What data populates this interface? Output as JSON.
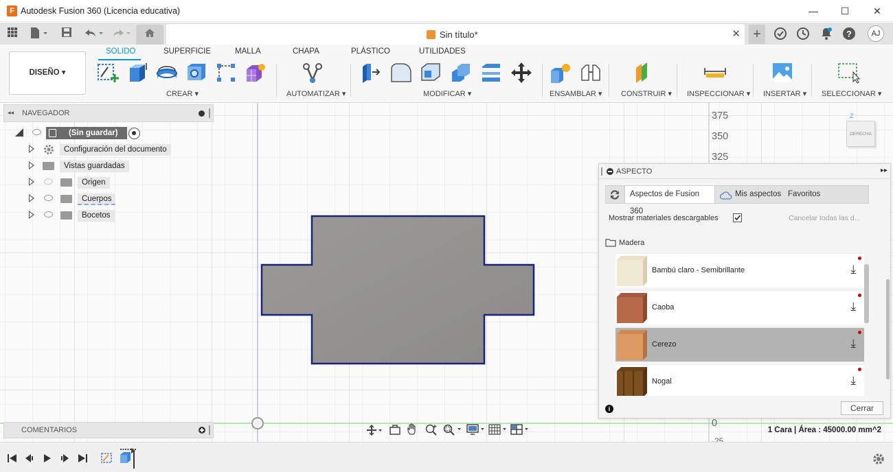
{
  "window": {
    "title": "Autodesk Fusion 360 (Licencia educativa)",
    "app_icon": "F",
    "minimize": "—",
    "maximize": "☐",
    "close": "✕"
  },
  "tabs": {
    "document_name": "Sin título*",
    "close_glyph": "✕",
    "add_glyph": "+",
    "user_initials": "AJ"
  },
  "ribbon": {
    "workspace_button": "DISEÑO ▾",
    "tabs": [
      "SOLIDO",
      "SUPERFICIE",
      "MALLA",
      "CHAPA",
      "PLÁSTICO",
      "UTILIDADES"
    ],
    "groups": [
      "CREAR ▾",
      "AUTOMATIZAR ▾",
      "MODIFICAR ▾",
      "ENSAMBLAR ▾",
      "CONSTRUIR ▾",
      "INSPECCIONAR ▾",
      "INSERTAR ▾",
      "SELECCIONAR ▾"
    ]
  },
  "browser": {
    "header": "NAVEGADOR",
    "collapse_glyph": "◂◂",
    "root": "(Sin guardar)",
    "items": [
      "Configuración del documento",
      "Vistas guardadas",
      "Origen",
      "Cuerpos",
      "Bocetos"
    ]
  },
  "ruler": {
    "labels": [
      "375",
      "350",
      "325",
      "0",
      "-25"
    ]
  },
  "viewcube": {
    "axis": "Z",
    "face": "DERECHA"
  },
  "appearance": {
    "header": "ASPECTO",
    "tabs": [
      "Aspectos de Fusion 360",
      "Mis aspectos",
      "Favoritos"
    ],
    "show_downloadable": "Mostrar materiales descargables",
    "cancel_all": "Cancelar todas las d...",
    "category": "Madera",
    "materials": [
      "Bambú claro - Semibrillante",
      "Caoba",
      "Cerezo",
      "Nogal"
    ],
    "selected_index": 2,
    "close_button": "Cerrar"
  },
  "comments": {
    "header": "COMENTARIOS"
  },
  "status": {
    "text": "1 Cara | Área : 45000.00 mm^2"
  }
}
